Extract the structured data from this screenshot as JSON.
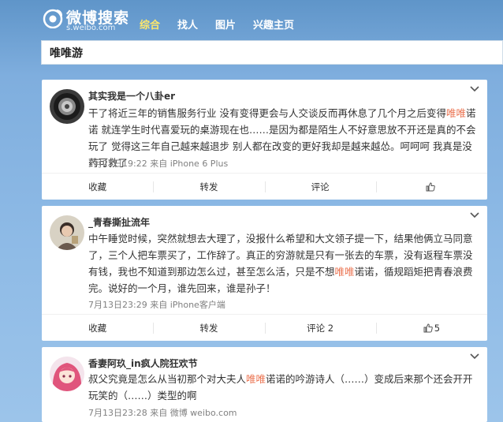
{
  "header": {
    "logo_name": "微博搜索",
    "logo_sub": "s.weibo.com",
    "nav": [
      "综合",
      "找人",
      "图片",
      "兴趣主页"
    ]
  },
  "search": {
    "value": "唯唯游"
  },
  "posts": [
    {
      "author": "其实我是一个八卦er",
      "text_parts": [
        "干了将近三年的销售服务行业 没有变得更会与人交谈反而再休息了几个月之后变得",
        "唯唯",
        "诺诺 就连学生时代喜爱玩的桌游现在也……是因为都是陌生人不好意思放不开还是真的不会玩了 觉得这三年自己越来越退步 别人都在改变的更好我却是越来越怂。呵呵呵 我真是没药可救了"
      ],
      "meta": "7月25日19:22 来自 iPhone 6 Plus",
      "actions": {
        "favorite": "收藏",
        "repost": "转发",
        "comment": "评论",
        "like": ""
      }
    },
    {
      "author": "_青春撕扯流年",
      "text_parts": [
        "中午睡觉时候，突然就想去大理了，没报什么希望和大文领子提一下，结果他俩立马同意了，三个人把车票买了，工作辞了。真正的穷游就是只有一张去的车票，没有返程车票没有钱，我也不知道到那边怎么过，甚至怎么活，只是不想",
        "唯唯",
        "诺诺，循规蹈矩把青春浪费完。说好的一个月，谁先回来，谁是孙子！"
      ],
      "meta": "7月13日23:29 来自 iPhone客户端",
      "actions": {
        "favorite": "收藏",
        "repost": "转发",
        "comment": "评论 2",
        "like": "5"
      }
    },
    {
      "author": "香妻阿玖_in疯人院狂欢节",
      "text_parts": [
        "叔父究竟是怎么从当初那个对大夫人",
        "唯唯",
        "诺诺的吟游诗人（……）变成后来那个还会开开玩笑的（……）类型的啊"
      ],
      "meta": "7月13日23:28 来自 微博 weibo.com"
    }
  ],
  "icons": [
    "weibo-logo-icon",
    "chevron-down-icon",
    "thumbs-up-icon"
  ],
  "colors": {
    "highlight": "#eb7350",
    "nav_active": "#ffe86b"
  }
}
